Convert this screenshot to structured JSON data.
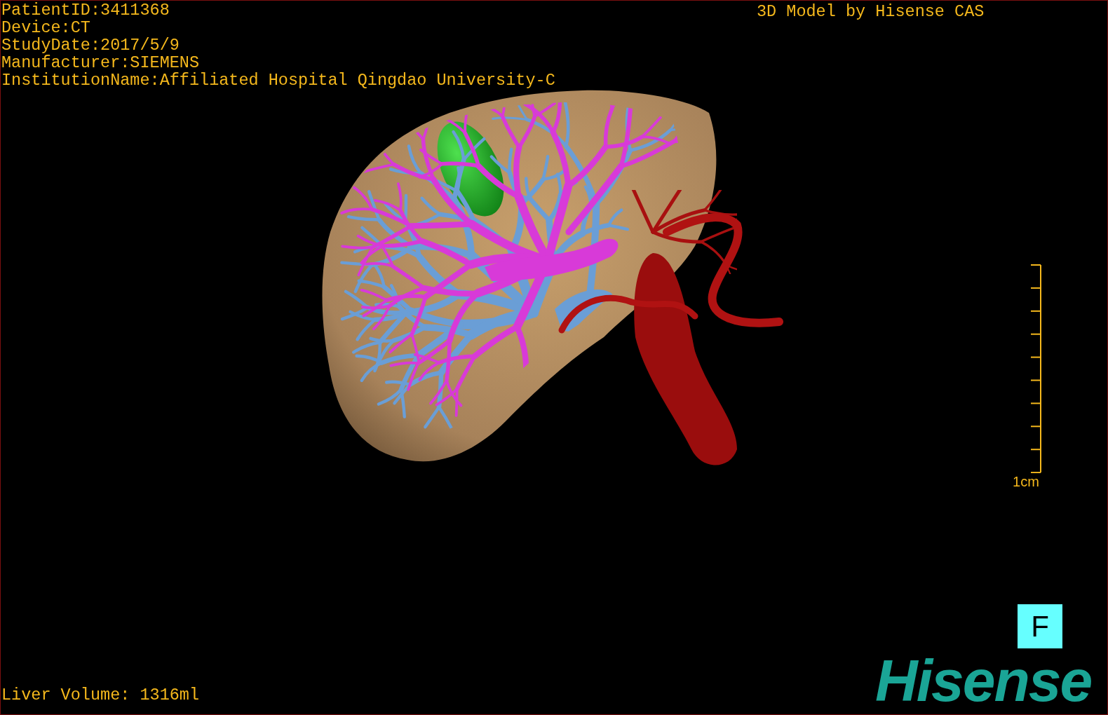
{
  "info_lines": [
    "PatientID:3411368",
    "Device:CT",
    "StudyDate:2017/5/9",
    "Manufacturer:SIEMENS",
    "InstitutionName:Affiliated Hospital Qingdao University-C"
  ],
  "title": "3D Model by Hisense CAS",
  "scale_bar": {
    "label": "1cm"
  },
  "orientation_marker": "F",
  "logo": "Hisense",
  "liver_volume": "Liver Volume: 1316ml"
}
